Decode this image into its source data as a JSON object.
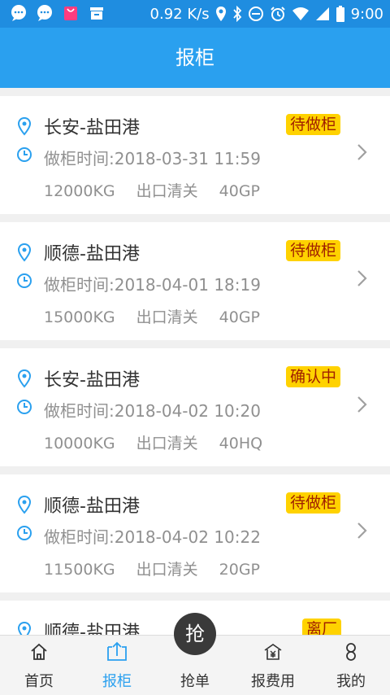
{
  "status_bar": {
    "network_speed": "0.92 K/s",
    "time": "9:00"
  },
  "header": {
    "title": "报柜"
  },
  "orders": [
    {
      "route": "长安-盐田港",
      "status": "待做柜",
      "time": "做柜时间:2018-03-31 11:59",
      "weight": "12000KG",
      "customs": "出口清关",
      "container": "40GP"
    },
    {
      "route": "顺德-盐田港",
      "status": "待做柜",
      "time": "做柜时间:2018-04-01 18:19",
      "weight": "15000KG",
      "customs": "出口清关",
      "container": "40GP"
    },
    {
      "route": "长安-盐田港",
      "status": "确认中",
      "time": "做柜时间:2018-04-02 10:20",
      "weight": "10000KG",
      "customs": "出口清关",
      "container": "40HQ"
    },
    {
      "route": "顺德-盐田港",
      "status": "待做柜",
      "time": "做柜时间:2018-04-02 10:22",
      "weight": "11500KG",
      "customs": "出口清关",
      "container": "20GP"
    },
    {
      "route": "顺德-盐田港",
      "status": "离厂"
    }
  ],
  "tabs": [
    {
      "label": "首页",
      "icon": "home-icon"
    },
    {
      "label": "报柜",
      "icon": "upload-box-icon",
      "active": true
    },
    {
      "label": "抢单",
      "icon": "grab-order-icon",
      "button_text": "抢"
    },
    {
      "label": "报费用",
      "icon": "fee-house-icon"
    },
    {
      "label": "我的",
      "icon": "person-icon"
    }
  ],
  "colors": {
    "status_bar": "#1f8de0",
    "header": "#2aa0ef",
    "badge": "#ffd200",
    "badge_text": "#a02000",
    "active_tab": "#2aa0ef"
  }
}
